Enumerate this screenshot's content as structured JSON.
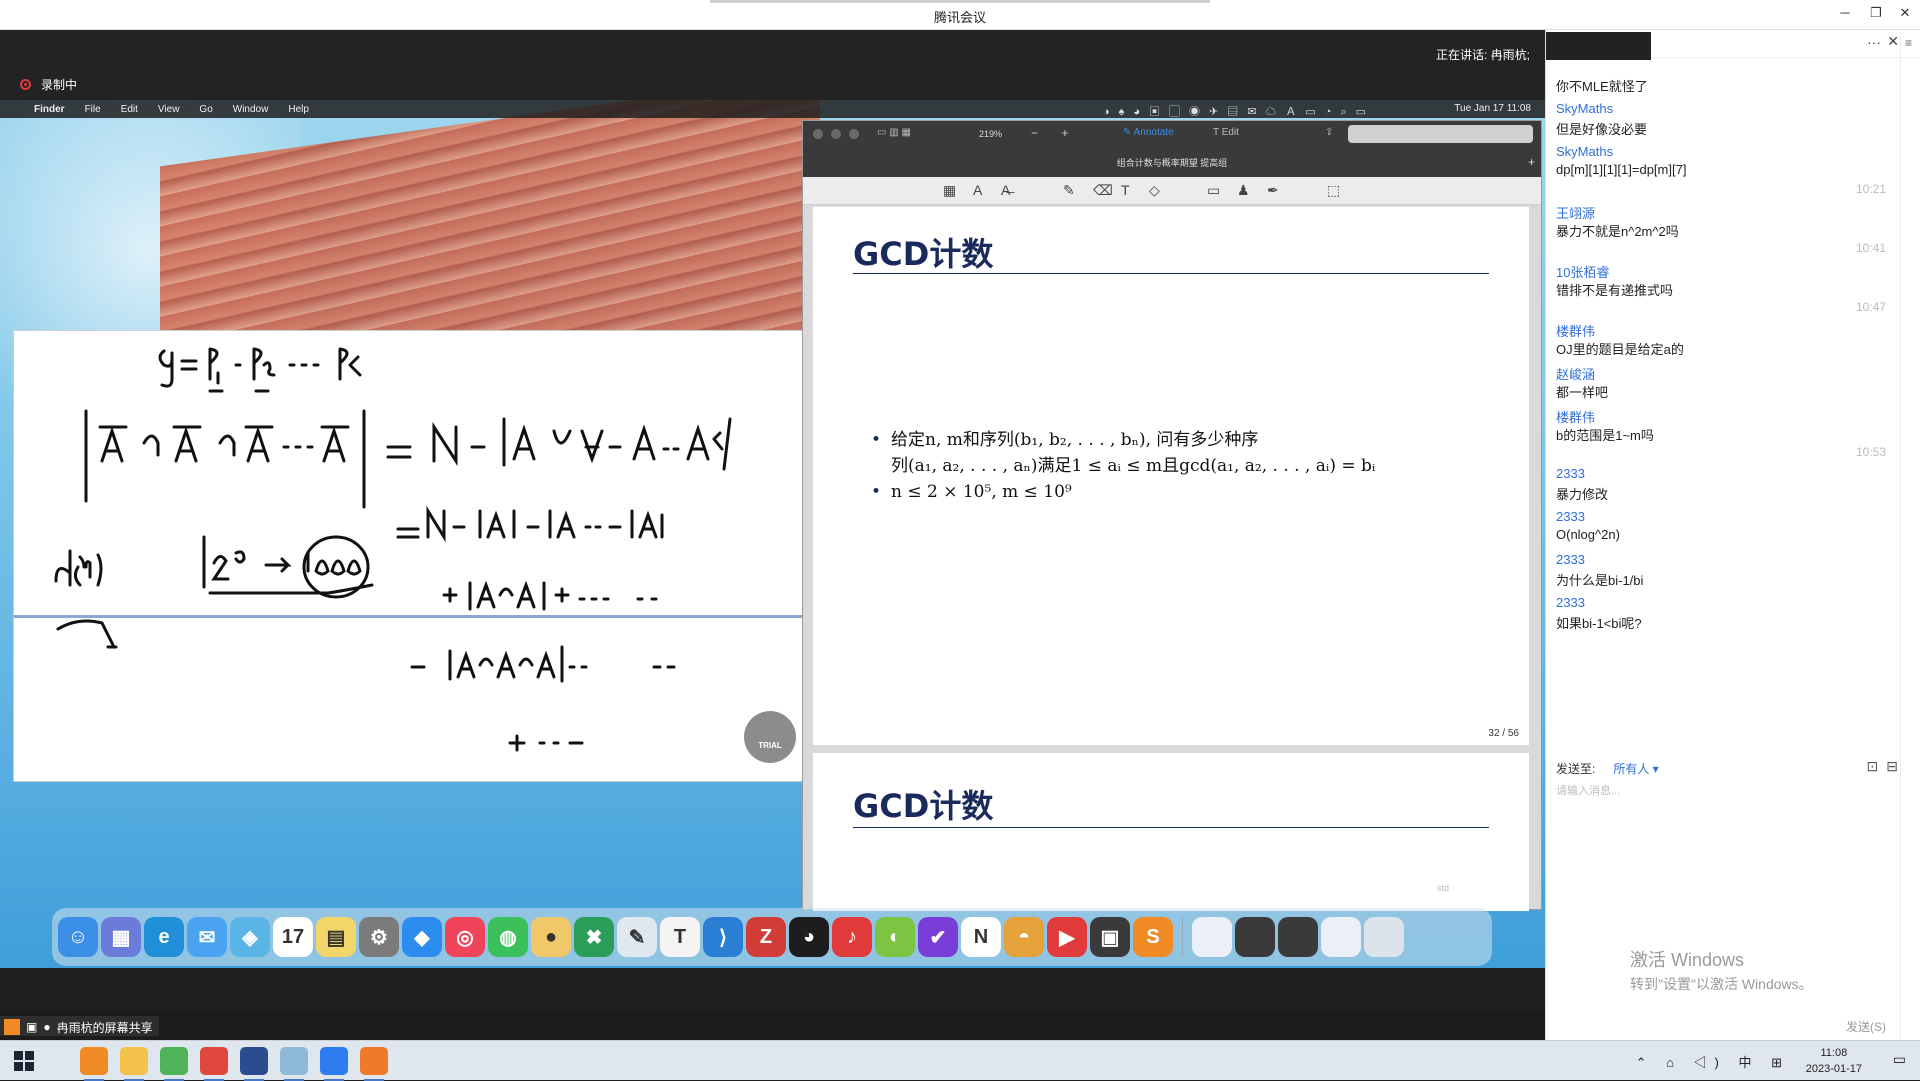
{
  "window": {
    "title": "腾讯会议",
    "minimize": "─",
    "restore": "❐",
    "close": "✕"
  },
  "meeting": {
    "speaking": "正在讲话: 冉雨杭;",
    "recording": "录制中",
    "share_label": "冉雨杭的屏幕共享"
  },
  "mac_menu": {
    "apple": "",
    "app": "Finder",
    "items": [
      "File",
      "Edit",
      "View",
      "Go",
      "Window",
      "Help"
    ],
    "clock": "Tue Jan 17  11:08"
  },
  "pdf": {
    "zoom": "219%",
    "tool_annotate": "Annotate",
    "tool_edit": "Edit",
    "doc_title": "组合计数与概率期望 提高组",
    "page1": {
      "title": "GCD计数",
      "bullet1_line1": "给定n, m和序列(b₁, b₂, . . . , bₙ), 问有多少种序",
      "bullet1_line2": "列(a₁, a₂, . . . , aₙ)满足1 ≤ aᵢ ≤ m且gcd(a₁, a₂, . . . , aᵢ) = bᵢ",
      "bullet2": "n ≤ 2 × 10⁵, m ≤ 10⁹",
      "page_number": "32 / 56"
    },
    "page2": {
      "title": "GCD计数",
      "stamp": "std"
    }
  },
  "board": {
    "trial": "TRIAL"
  },
  "dock": {
    "items": [
      {
        "name": "finder",
        "color": "#3b8fe6",
        "glyph": "☺"
      },
      {
        "name": "launchpad",
        "color": "#6b7bd9",
        "glyph": "▦"
      },
      {
        "name": "edge",
        "color": "#1f8fd8",
        "glyph": "e"
      },
      {
        "name": "mail",
        "color": "#4aa3f0",
        "glyph": "✉"
      },
      {
        "name": "maps",
        "color": "#5ab5e6",
        "glyph": "◈"
      },
      {
        "name": "calendar",
        "color": "#ffffff",
        "glyph": "17"
      },
      {
        "name": "notes",
        "color": "#f3d66a",
        "glyph": "▤"
      },
      {
        "name": "settings",
        "color": "#7b7b7b",
        "glyph": "⚙"
      },
      {
        "name": "lark",
        "color": "#2c8cf0",
        "glyph": "◆"
      },
      {
        "name": "netease",
        "color": "#f0445a",
        "glyph": "◎"
      },
      {
        "name": "wechat",
        "color": "#3cc05c",
        "glyph": "◍"
      },
      {
        "name": "app-yellow",
        "color": "#f0c86a",
        "glyph": "●"
      },
      {
        "name": "xmind",
        "color": "#2a9d5a",
        "glyph": "✖"
      },
      {
        "name": "editor",
        "color": "#dfe7ef",
        "glyph": "✎"
      },
      {
        "name": "typora",
        "color": "#f4f4f4",
        "glyph": "T"
      },
      {
        "name": "vscode",
        "color": "#2a7fd4",
        "glyph": "⟩"
      },
      {
        "name": "zotero",
        "color": "#d13c36",
        "glyph": "Z"
      },
      {
        "name": "qq",
        "color": "#1d1d1d",
        "glyph": "◕"
      },
      {
        "name": "netease-music",
        "color": "#e13a3a",
        "glyph": "♪"
      },
      {
        "name": "app-green",
        "color": "#7cc441",
        "glyph": "◐"
      },
      {
        "name": "todo",
        "color": "#7a3ed8",
        "glyph": "✔"
      },
      {
        "name": "notion",
        "color": "#ffffff",
        "glyph": "N"
      },
      {
        "name": "app-orange",
        "color": "#e5a13a",
        "glyph": "◓"
      },
      {
        "name": "pdf-expert",
        "color": "#e13a3a",
        "glyph": "▶"
      },
      {
        "name": "screenshot",
        "color": "#3a3a3a",
        "glyph": "▣"
      },
      {
        "name": "sublime",
        "color": "#f08a24",
        "glyph": "S"
      }
    ],
    "right_items": [
      {
        "name": "window-1",
        "color": "#eaf0f6"
      },
      {
        "name": "window-2",
        "color": "#3a3a3a"
      },
      {
        "name": "window-3",
        "color": "#3a3a3a"
      },
      {
        "name": "window-4",
        "color": "#eaf0f6"
      },
      {
        "name": "trash",
        "color": "#dde3ea"
      }
    ]
  },
  "chat": {
    "messages": [
      {
        "text": "你不MLE就怪了"
      },
      {
        "name": "SkyMaths",
        "text": "但是好像没必要"
      },
      {
        "name": "SkyMaths",
        "text": "dp[m][1][1][1]=dp[m][7]",
        "time": "10:21"
      },
      {
        "name": "王翊源",
        "text": "暴力不就是n^2m^2吗",
        "time": "10:41"
      },
      {
        "name": "10张栢睿",
        "text": "错排不是有递推式吗",
        "time": "10:47"
      },
      {
        "name": "楼群伟",
        "text": "OJ里的题目是给定a的"
      },
      {
        "name": "赵峻涵",
        "text": "都一样吧"
      },
      {
        "name": "楼群伟",
        "text": "b的范围是1~m吗",
        "time": "10:53"
      },
      {
        "name": "2333",
        "text": "暴力修改"
      },
      {
        "name": "2333",
        "text": "O(nlog^2n)"
      },
      {
        "name": "2333",
        "text": "为什么是bi-1/bi"
      },
      {
        "name": "2333",
        "text": "如果bi-1<bi呢?"
      }
    ],
    "send_to_label": "发送至:",
    "send_to_value": "所有人 ▾",
    "input_placeholder": "请输入消息...",
    "activate_title": "激活 Windows",
    "activate_sub": "转到\"设置\"以激活 Windows。",
    "send_button": "发送(S)",
    "more": "···",
    "close": "✕",
    "side_icon": "≡"
  },
  "taskbar": {
    "apps": [
      {
        "name": "sublime-text",
        "color": "#f08a24"
      },
      {
        "name": "file-explorer",
        "color": "#f2c24a"
      },
      {
        "name": "edge-green",
        "color": "#4fb35a"
      },
      {
        "name": "chrome",
        "color": "#e0473c"
      },
      {
        "name": "dev-cpp",
        "color": "#2a4d8f"
      },
      {
        "name": "notepad",
        "color": "#8fb9d9"
      },
      {
        "name": "tencent-meeting",
        "color": "#2f7bf0"
      },
      {
        "name": "firefox",
        "color": "#f07a2a"
      }
    ],
    "tray": "⌃ ⌂ ◁) 中 ⊞",
    "time": "11:08",
    "date": "2023-01-17",
    "notification": "▭"
  }
}
